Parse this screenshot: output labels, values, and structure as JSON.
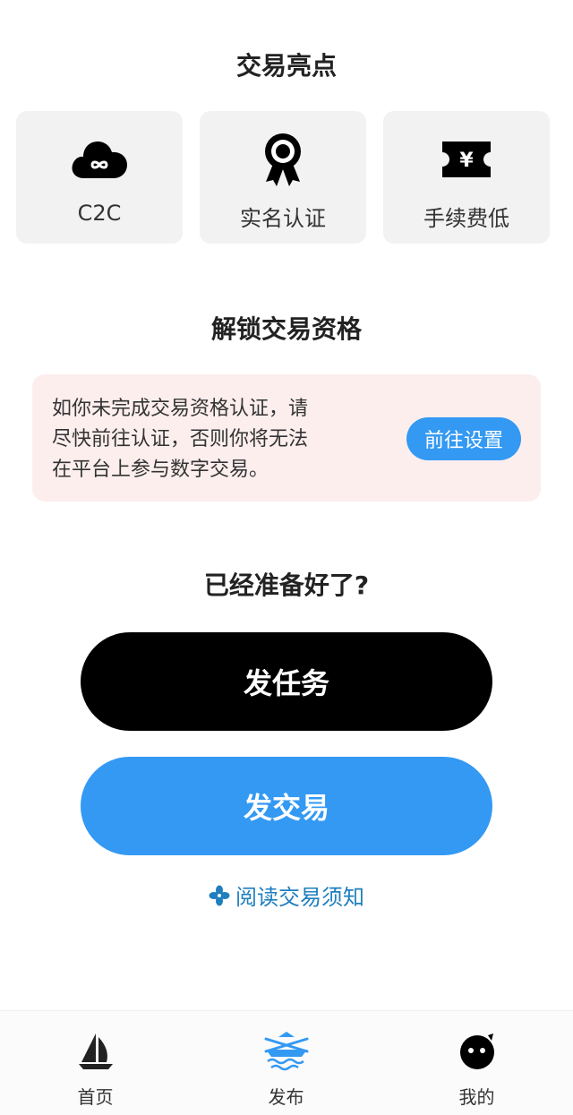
{
  "highlights": {
    "title": "交易亮点",
    "items": [
      {
        "label": "C2C",
        "icon": "cloud-infinity-icon"
      },
      {
        "label": "实名认证",
        "icon": "award-ribbon-icon"
      },
      {
        "label": "手续费低",
        "icon": "yen-ticket-icon"
      }
    ]
  },
  "unlock": {
    "title": "解锁交易资格",
    "notice_lines": [
      "如你未完成交易资格认证，请",
      "尽快前往认证，否则你将无法",
      "在平台上参与数字交易。"
    ],
    "button_label": "前往设置"
  },
  "ready": {
    "title": "已经准备好了?",
    "task_button": "发任务",
    "trade_button": "发交易",
    "read_link": "阅读交易须知"
  },
  "tabbar": {
    "items": [
      {
        "label": "首页",
        "icon": "sailboat-icon"
      },
      {
        "label": "发布",
        "icon": "rowing-boat-icon",
        "active": true
      },
      {
        "label": "我的",
        "icon": "face-icon"
      }
    ]
  },
  "colors": {
    "accent": "#3399f3",
    "link": "#1f7fbf",
    "notice_bg": "#fdeeee",
    "card_bg": "#f2f2f2"
  }
}
